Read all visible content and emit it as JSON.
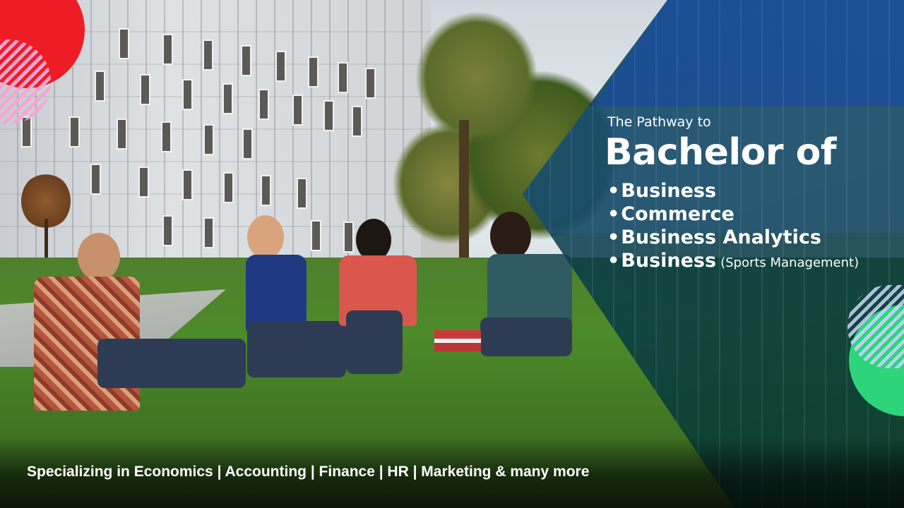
{
  "banner": {
    "kicker": "The Pathway to",
    "title": "Bachelor of",
    "courses": [
      {
        "bullet": "•",
        "name": "Business",
        "note": ""
      },
      {
        "bullet": "•",
        "name": "Commerce",
        "note": ""
      },
      {
        "bullet": "•",
        "name": "Business Analytics",
        "note": ""
      },
      {
        "bullet": "•",
        "name": "Business",
        "note": "(Sports Management)"
      }
    ],
    "tagline": "Specializing in Economics | Accounting | Finance | HR | Marketing & many more"
  },
  "colors": {
    "accent_red": "#ee1d25",
    "accent_green": "#2ed47a",
    "overlay_teal": "#0a465e",
    "text": "#ffffff"
  },
  "icons": [
    "red-circle-shape",
    "striped-circle-shape",
    "green-circle-shape"
  ]
}
